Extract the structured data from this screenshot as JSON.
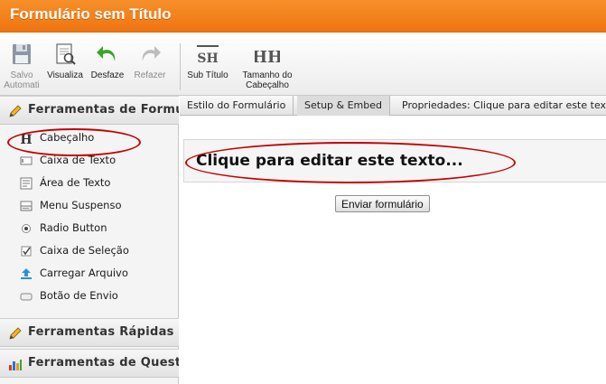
{
  "window": {
    "title": "Formulário sem Título"
  },
  "toolbar": {
    "save": {
      "line1": "Salvo",
      "line2": "Automati"
    },
    "preview": {
      "label": "Visualiza"
    },
    "undo": {
      "label": "Desfaze"
    },
    "redo": {
      "label": "Refazer"
    },
    "subtitle": {
      "label": "Sub Título",
      "icon_text": "SH"
    },
    "header_size": {
      "line1": "Tamanho do",
      "line2": "Cabeçalho",
      "icon_text": "HH"
    }
  },
  "sidebar": {
    "form_tools": {
      "title": "Ferramentas de Formulário",
      "items": [
        {
          "label": "Cabeçalho",
          "icon": "heading-icon"
        },
        {
          "label": "Caixa de Texto",
          "icon": "textbox-icon"
        },
        {
          "label": "Área de Texto",
          "icon": "textarea-icon"
        },
        {
          "label": "Menu Suspenso",
          "icon": "dropdown-icon"
        },
        {
          "label": "Radio Button",
          "icon": "radio-icon"
        },
        {
          "label": "Caixa de Seleção",
          "icon": "checkbox-icon"
        },
        {
          "label": "Carregar Arquivo",
          "icon": "upload-icon"
        },
        {
          "label": "Botão de Envio",
          "icon": "submit-button-icon"
        }
      ]
    },
    "quick_tools": {
      "title": "Ferramentas Rápidas"
    },
    "survey_tools": {
      "title": "Ferramentas de Questionário"
    }
  },
  "tabs": [
    {
      "label": "Estilo do Formulário"
    },
    {
      "label": "Setup & Embed"
    }
  ],
  "properties": {
    "label": "Propriedades: Clique para editar este texto"
  },
  "form": {
    "header_text": "Clique para editar este texto...",
    "submit_label": "Enviar formulário"
  },
  "colors": {
    "title_bar": "#ef7411",
    "highlight_ellipse": "#c40000"
  }
}
